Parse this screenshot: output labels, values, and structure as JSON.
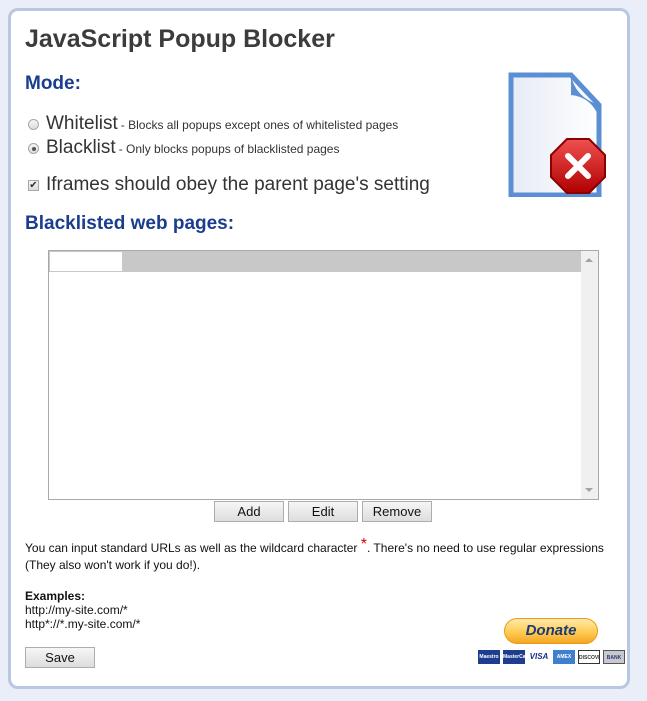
{
  "title": "JavaScript Popup Blocker",
  "mode": {
    "heading": "Mode:",
    "options": [
      {
        "label": "Whitelist",
        "description": "- Blocks all popups except ones of whitelisted pages",
        "selected": false
      },
      {
        "label": "Blacklist",
        "description": "- Only blocks popups of blacklisted pages",
        "selected": true
      }
    ],
    "iframes": {
      "label": "Iframes should obey the parent page's setting",
      "checked": true
    }
  },
  "list": {
    "heading": "Blacklisted web pages:",
    "items": []
  },
  "buttons": {
    "add": "Add",
    "edit": "Edit",
    "remove": "Remove",
    "save": "Save"
  },
  "info": {
    "text_before": "You can input standard URLs as well as the wildcard character ",
    "asterisk": "*",
    "text_after": ". There's no need to use regular expressions (They also won't work if you do!)."
  },
  "examples": {
    "heading": "Examples:",
    "items": [
      "http://my-site.com/*",
      "http*://*.my-site.com/*"
    ]
  },
  "donate": {
    "label": "Donate",
    "cards": [
      "Maestro",
      "MasterCard",
      "VISA",
      "AMEX",
      "DISCOVER",
      "BANK"
    ]
  },
  "icons": {
    "header_icon": "blocked-document-icon"
  }
}
